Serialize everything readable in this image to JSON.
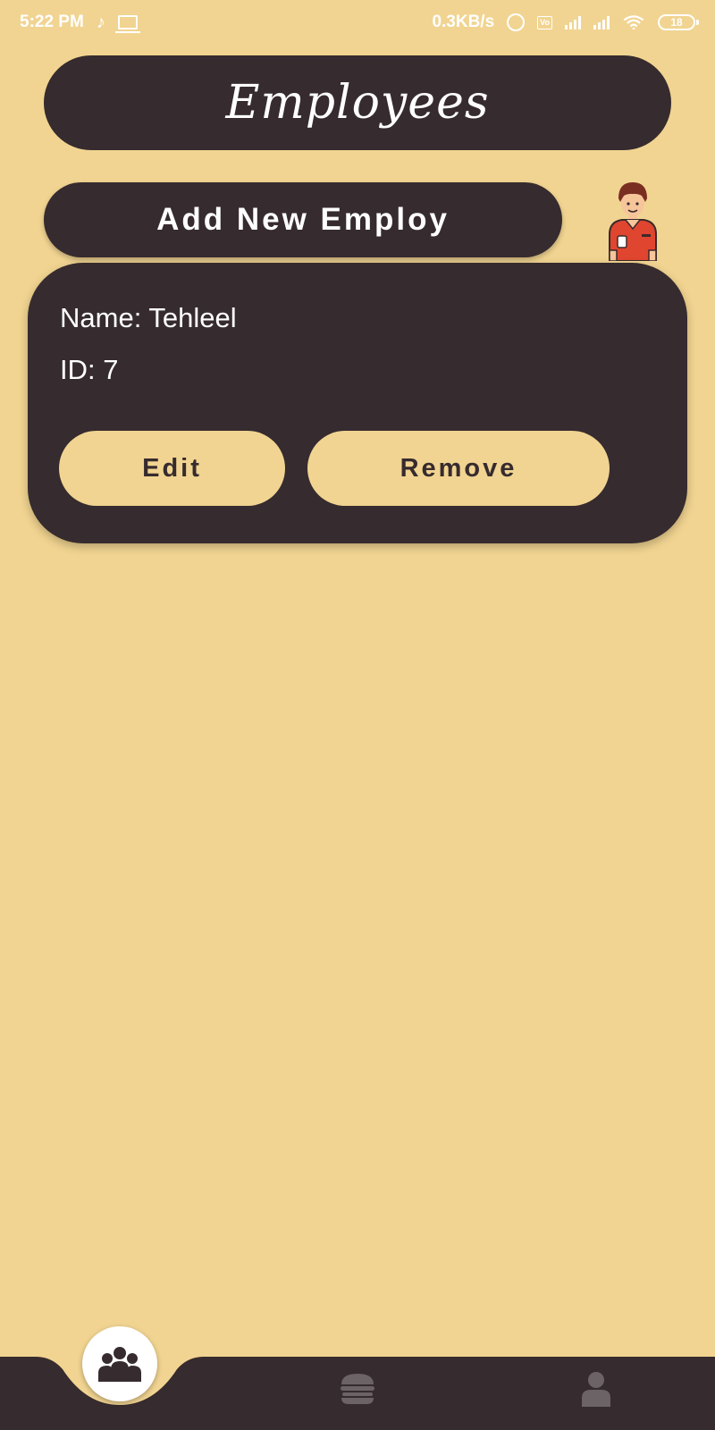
{
  "status_bar": {
    "time": "5:22 PM",
    "net_speed": "0.3KB/s",
    "volte": "VoLTE",
    "battery": "18"
  },
  "header": {
    "title": "Employees"
  },
  "add_button": {
    "label": "Add New Employ"
  },
  "employees": [
    {
      "name_line": "Name: Tehleel",
      "id_line": "ID: 7",
      "edit_label": "Edit",
      "remove_label": "Remove"
    }
  ],
  "bottom_nav": {
    "items": [
      {
        "icon": "group-icon",
        "active": true
      },
      {
        "icon": "burger-icon",
        "active": false
      },
      {
        "icon": "person-icon",
        "active": false
      }
    ]
  },
  "colors": {
    "background": "#f1d491",
    "dark": "#362b2e",
    "text_light": "#ffffff",
    "inactive_icon": "#6b6366"
  }
}
